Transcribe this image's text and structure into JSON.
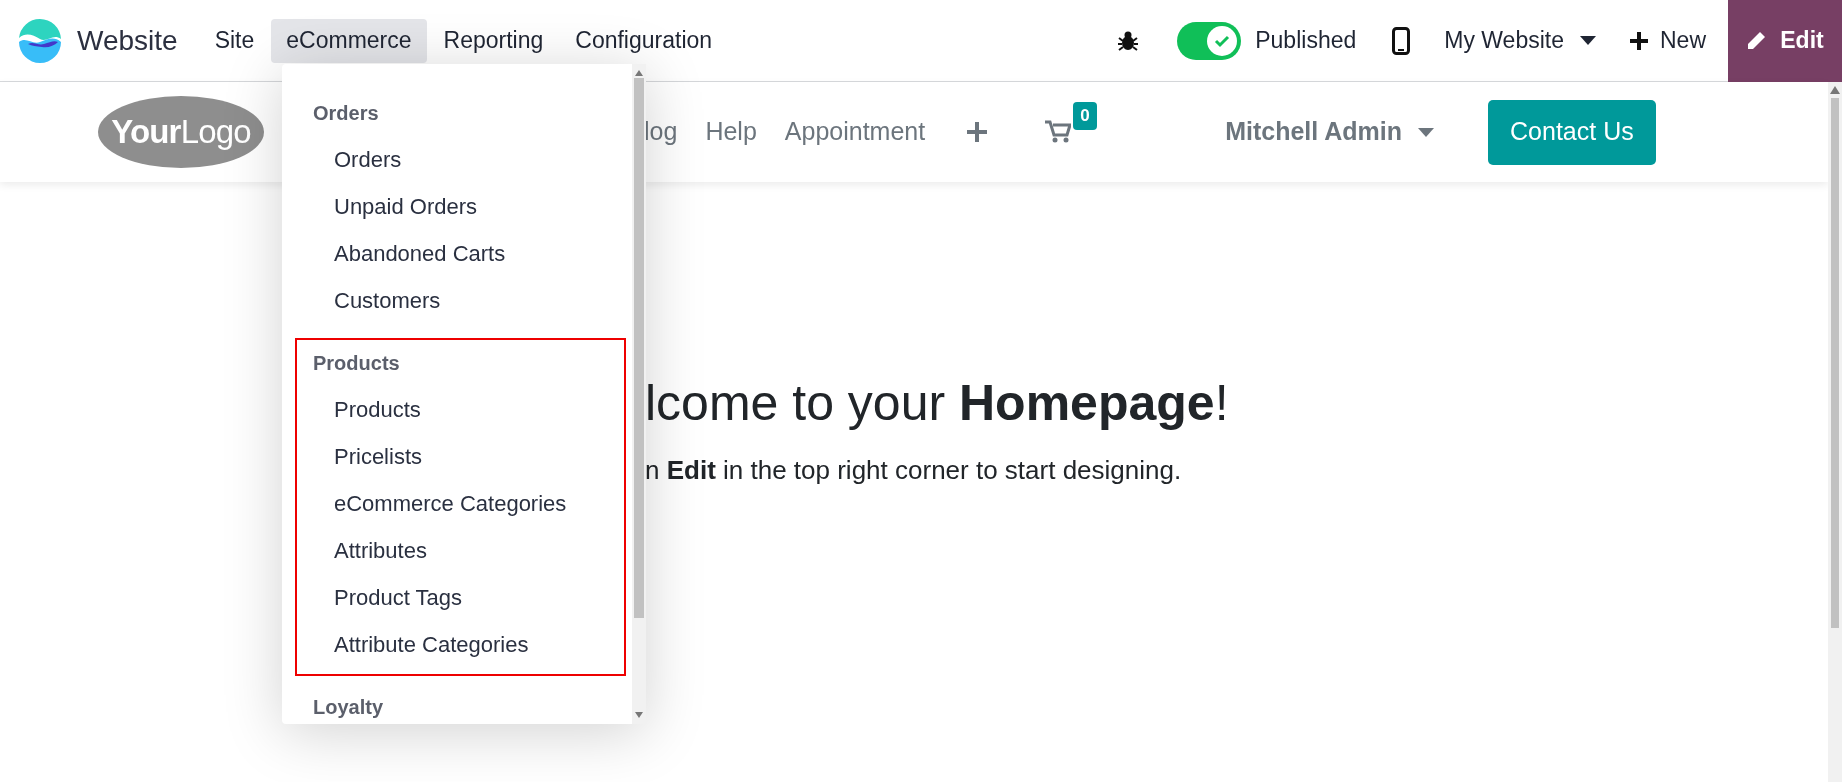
{
  "topbar": {
    "app_name": "Website",
    "menus": [
      {
        "label": "Site",
        "selected": false
      },
      {
        "label": "eCommerce",
        "selected": true
      },
      {
        "label": "Reporting",
        "selected": false
      },
      {
        "label": "Configuration",
        "selected": false
      }
    ],
    "published": {
      "label": "Published",
      "on": true
    },
    "website_selector": "My Website",
    "new_button": "New",
    "edit_button": "Edit"
  },
  "site_header": {
    "logo": "**Your**Logo",
    "nav": [
      "log",
      "Help",
      "Appointment"
    ],
    "cart_count": "0",
    "user": "Mitchell Admin",
    "contact_button": "Contact Us"
  },
  "dropdown": {
    "sections": [
      {
        "title": "Orders",
        "highlighted": false,
        "items": [
          "Orders",
          "Unpaid Orders",
          "Abandoned Carts",
          "Customers"
        ]
      },
      {
        "title": "Products",
        "highlighted": true,
        "items": [
          "Products",
          "Pricelists",
          "eCommerce Categories",
          "Attributes",
          "Product Tags",
          "Attribute Categories"
        ]
      },
      {
        "title": "Loyalty",
        "highlighted": false
      }
    ]
  },
  "homepage": {
    "heading": "lcome to your **Homepage**!",
    "subtitle": "n **Edit** in the top right corner to start designing."
  }
}
